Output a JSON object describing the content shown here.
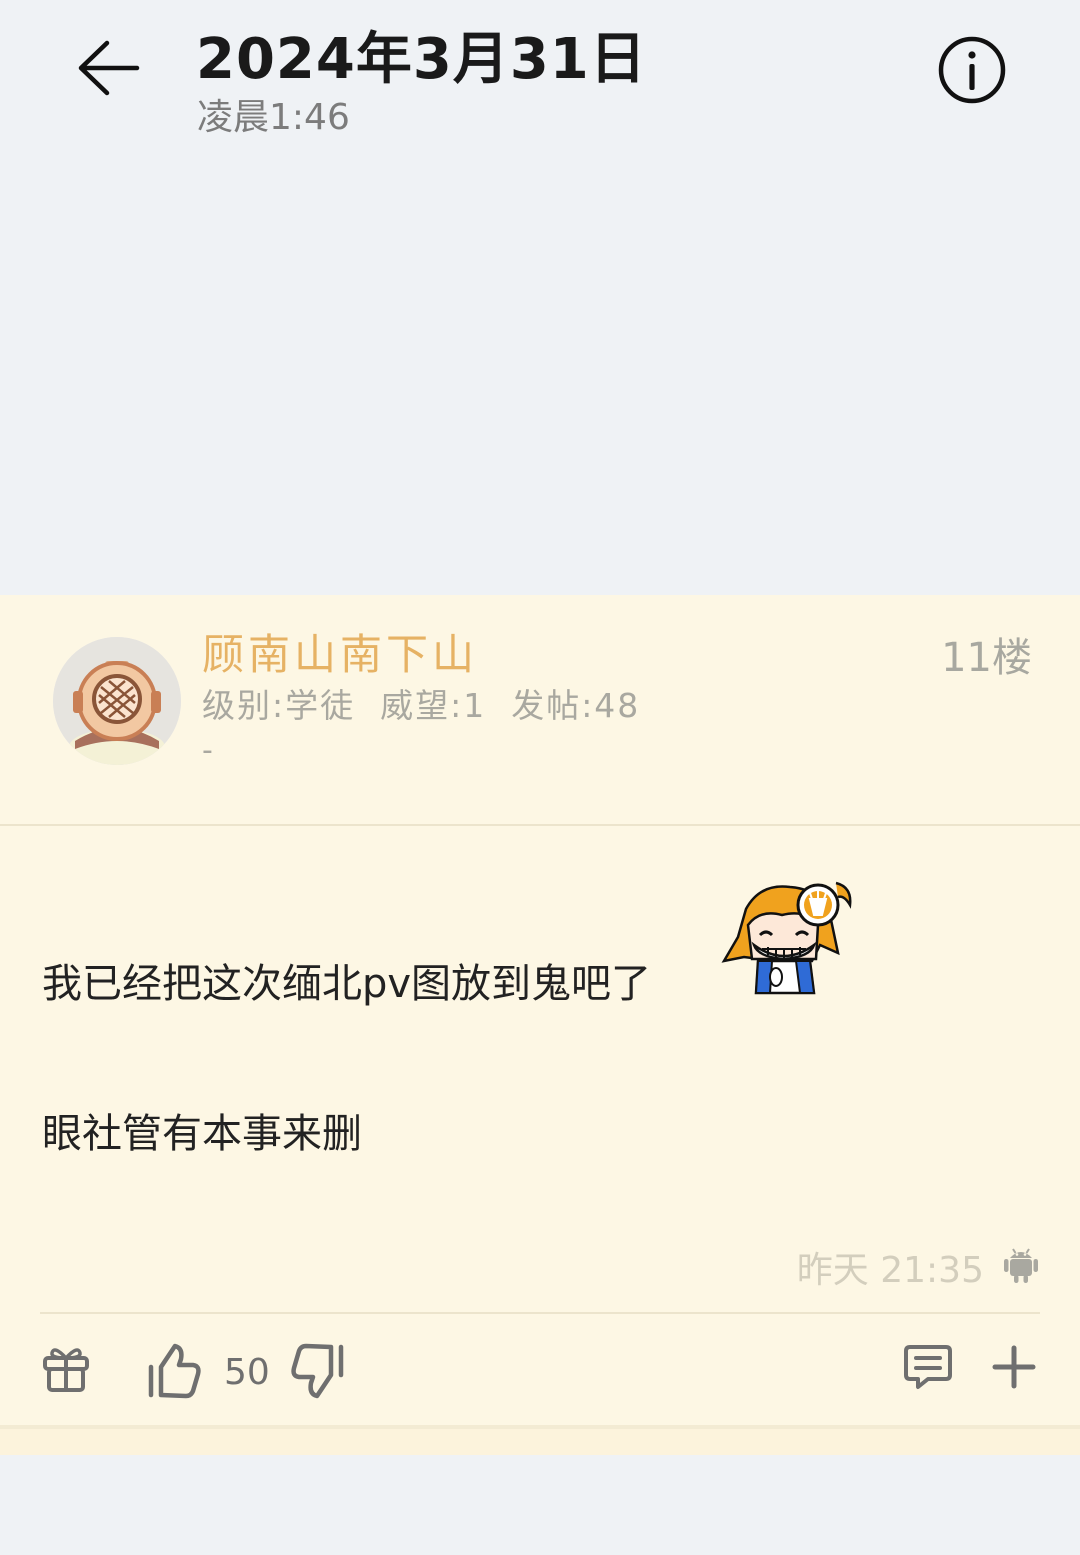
{
  "header": {
    "title": "2024年3月31日",
    "subtitle": "凌晨1:46",
    "back_icon": "arrow-left-icon",
    "info_icon": "info-circle-icon"
  },
  "post": {
    "username": "顾南山南下山",
    "floor": "11楼",
    "user_stats": "级别:学徒  威望:1  发帖:48",
    "user_sign": "-",
    "content_line1": "我已经把这次缅北pv图放到鬼吧了",
    "content_line2": "眼社管有本事来删",
    "sticker": "grinning-cartoon-girl-sticker",
    "time": "昨天 21:35",
    "client_icon": "android-icon",
    "actions": {
      "like_count": "50",
      "gift_icon": "gift-icon",
      "like_icon": "thumbs-up-icon",
      "dislike_icon": "thumbs-down-icon",
      "comment_icon": "comment-icon",
      "plus_icon": "plus-icon"
    }
  },
  "colors": {
    "background": "#eff2f5",
    "post_background": "#fdf7e4",
    "username": "#e6b264",
    "muted_text": "#a9a8a0"
  }
}
